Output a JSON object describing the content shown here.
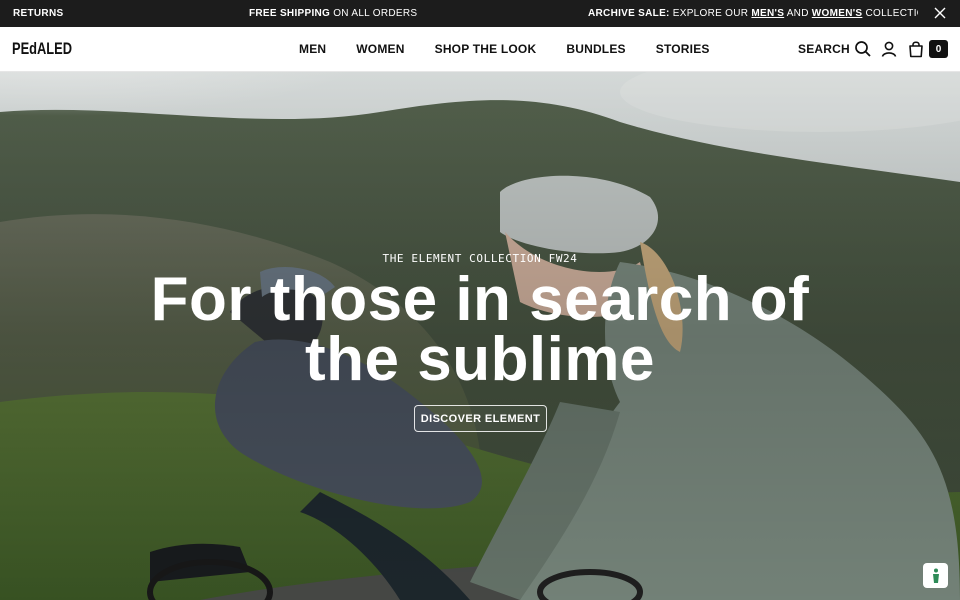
{
  "announcement": {
    "seg1": "RETURNS",
    "seg2_bold": "FREE SHIPPING",
    "seg2_rest": " ON ALL ORDERS",
    "seg3_bold": "ARCHIVE SALE:",
    "seg3_a": " EXPLORE OUR ",
    "seg3_link1": "MEN'S",
    "seg3_b": " AND ",
    "seg3_link2": "WOMEN'S",
    "seg3_c": " COLLECTION - UP TO"
  },
  "header": {
    "logo_text": "PEdALED",
    "nav": [
      "MEN",
      "WOMEN",
      "SHOP THE LOOK",
      "BUNDLES",
      "STORIES"
    ],
    "search_label": "SEARCH",
    "cart_count": "0"
  },
  "hero": {
    "eyebrow": "THE ELEMENT COLLECTION FW24",
    "headline_line1": "For those in search of",
    "headline_line2": "the sublime",
    "cta_label": "DISCOVER ELEMENT"
  },
  "icons": {
    "close": "close-icon",
    "search": "search-icon",
    "account": "user-icon",
    "bag": "shopping-bag-icon",
    "help": "accessibility-icon"
  },
  "colors": {
    "announcement_bg": "#1c1c1c",
    "header_bg": "#ffffff",
    "text_dark": "#111111",
    "help_icon": "#2e8b57"
  }
}
